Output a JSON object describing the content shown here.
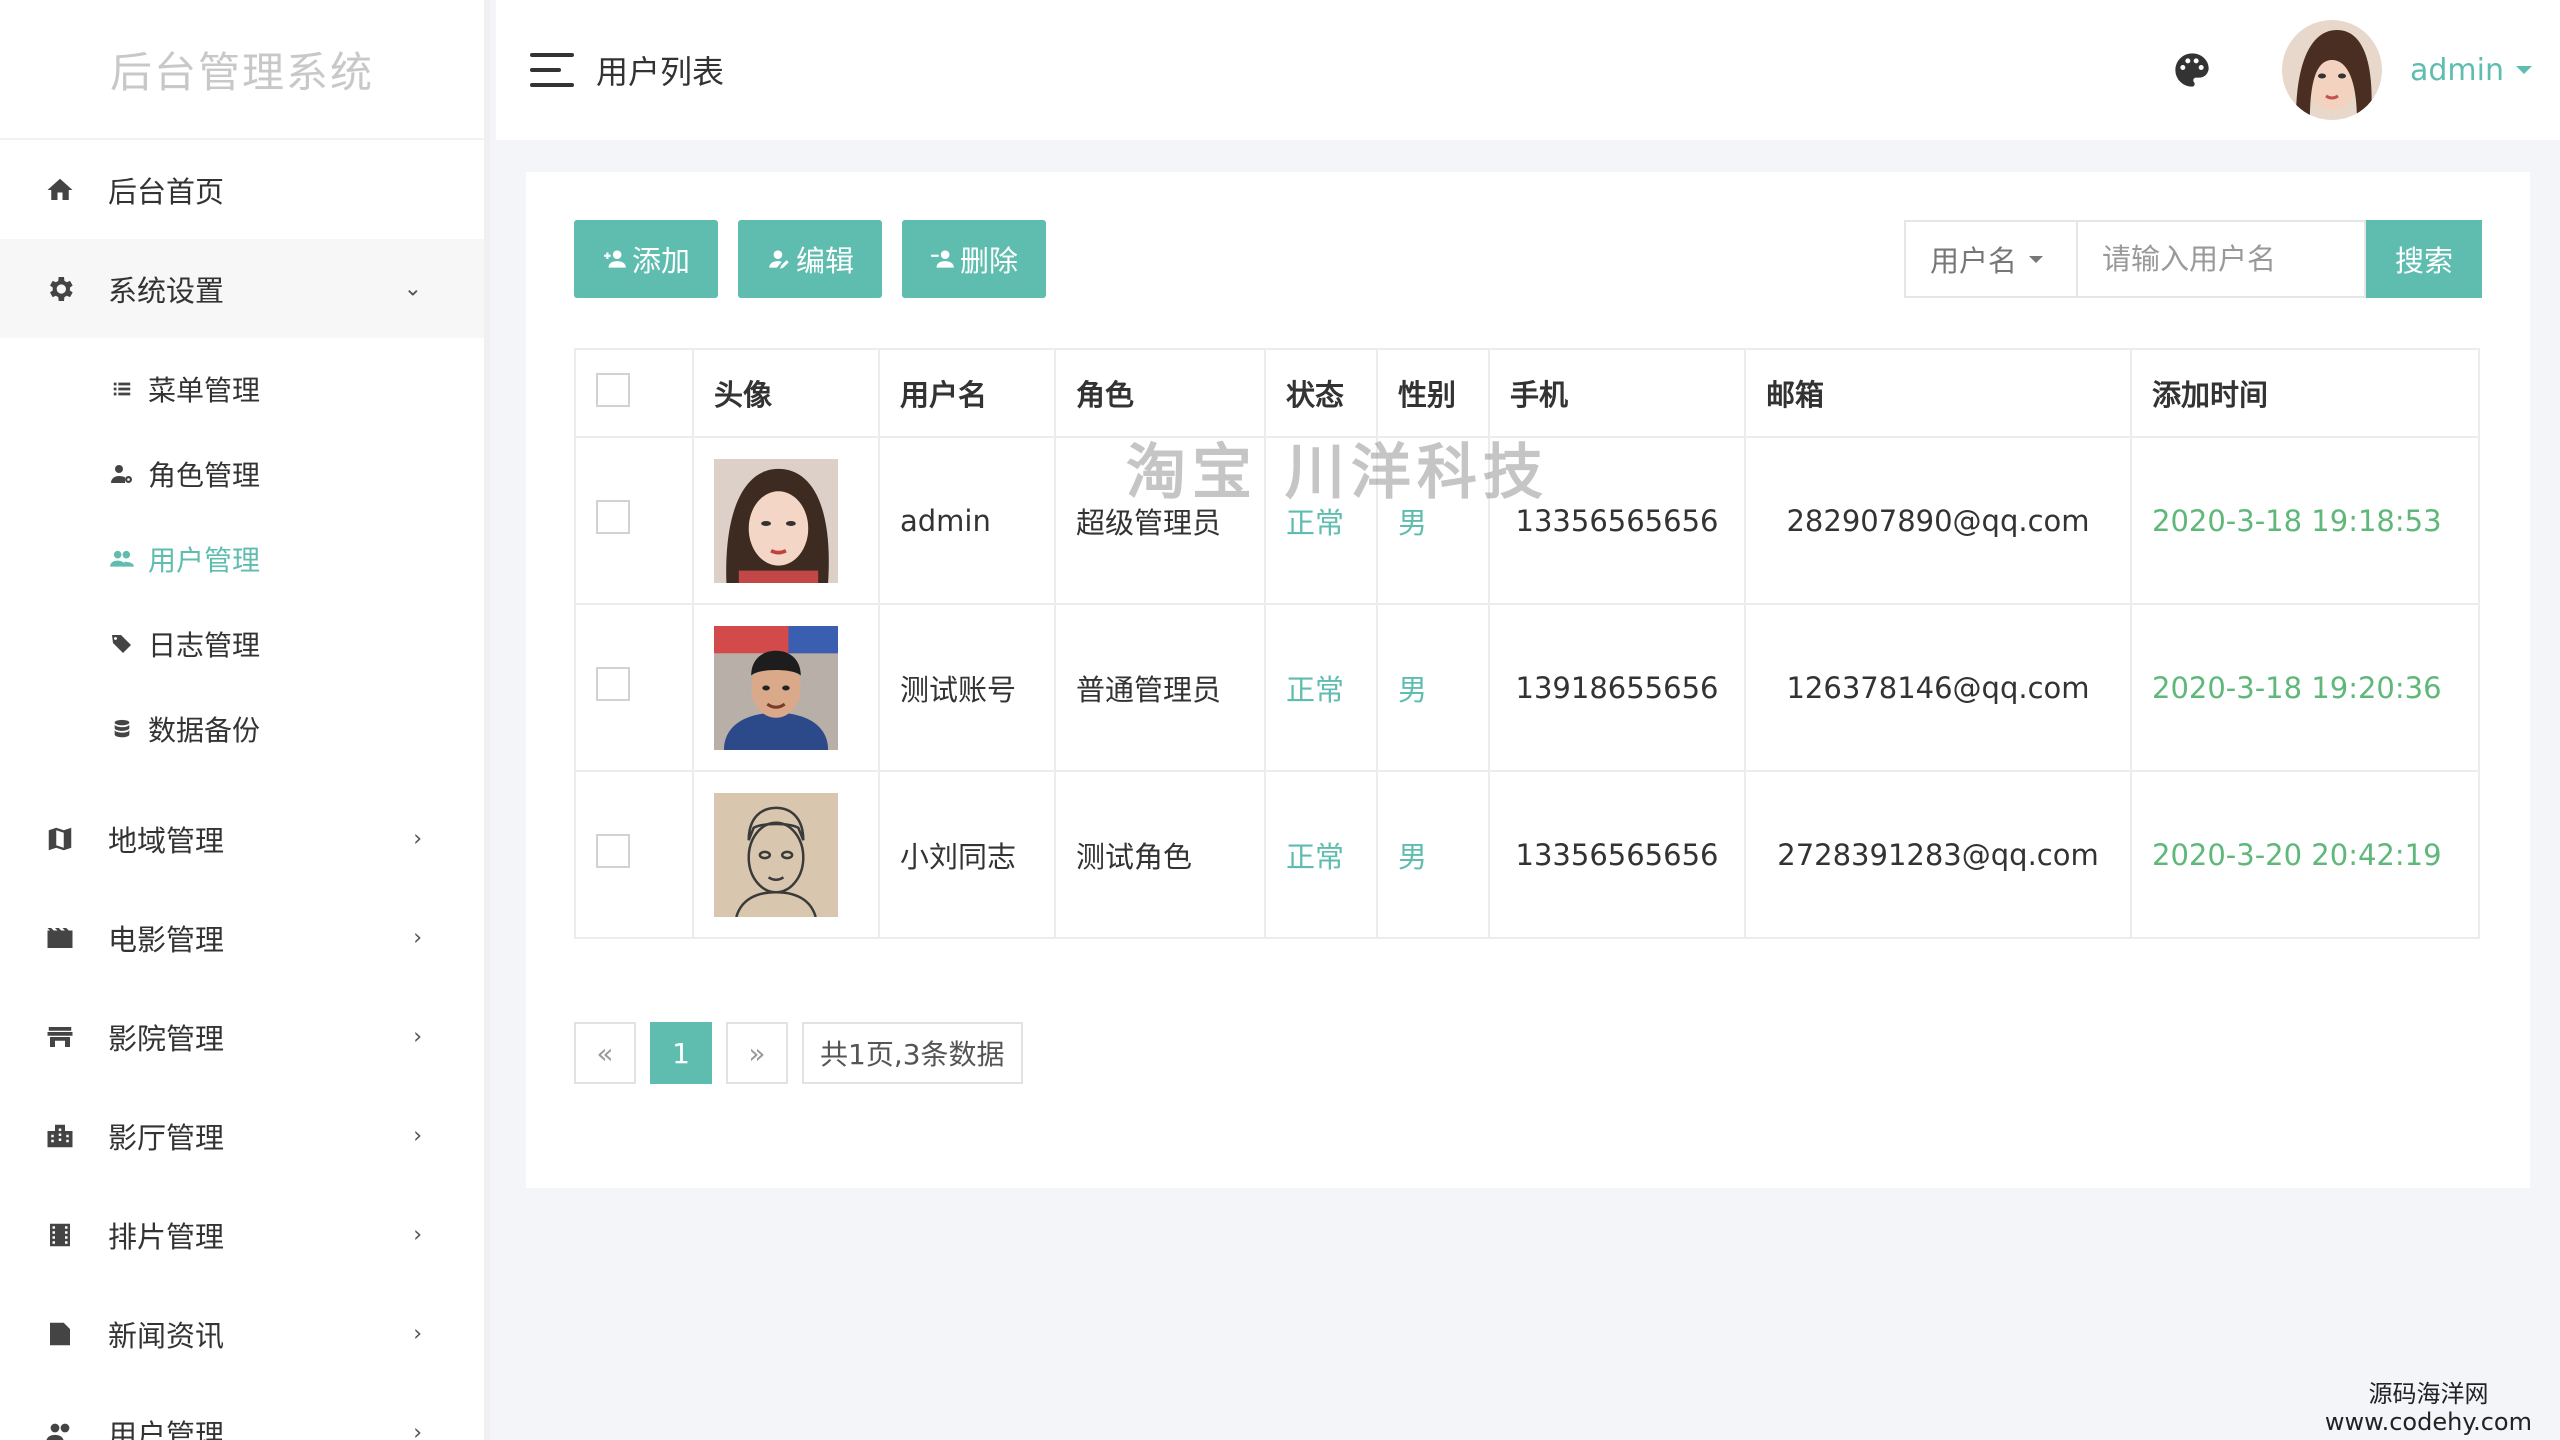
{
  "sidebar": {
    "logo": "后台管理系统",
    "home": "后台首页",
    "settings": "系统设置",
    "sub": [
      "菜单管理",
      "角色管理",
      "用户管理",
      "日志管理",
      "数据备份"
    ],
    "items": [
      "地域管理",
      "电影管理",
      "影院管理",
      "影厅管理",
      "排片管理",
      "新闻资讯",
      "用户管理"
    ]
  },
  "header": {
    "title": "用户列表",
    "username": "admin"
  },
  "toolbar": {
    "add": "添加",
    "edit": "编辑",
    "delete": "删除"
  },
  "search": {
    "field": "用户名",
    "placeholder": "请输入用户名",
    "button": "搜索"
  },
  "table": {
    "headers": [
      "头像",
      "用户名",
      "角色",
      "状态",
      "性别",
      "手机",
      "邮箱",
      "添加时间"
    ],
    "rows": [
      {
        "username": "admin",
        "role": "超级管理员",
        "status": "正常",
        "gender": "男",
        "phone": "13356565656",
        "email": "282907890@qq.com",
        "time": "2020-3-18 19:18:53"
      },
      {
        "username": "测试账号",
        "role": "普通管理员",
        "status": "正常",
        "gender": "男",
        "phone": "13918655656",
        "email": "126378146@qq.com",
        "time": "2020-3-18 19:20:36"
      },
      {
        "username": "小刘同志",
        "role": "测试角色",
        "status": "正常",
        "gender": "男",
        "phone": "13356565656",
        "email": "2728391283@qq.com",
        "time": "2020-3-20 20:42:19"
      }
    ]
  },
  "pager": {
    "prev": "«",
    "current": "1",
    "next": "»",
    "info": "共1页,3条数据"
  },
  "watermark": "淘宝 川洋科技",
  "corner": {
    "line1": "源码海洋网",
    "line2": "www.codehy.com"
  },
  "colors": {
    "accent": "#5fbdb0",
    "time": "#5fb87a"
  }
}
